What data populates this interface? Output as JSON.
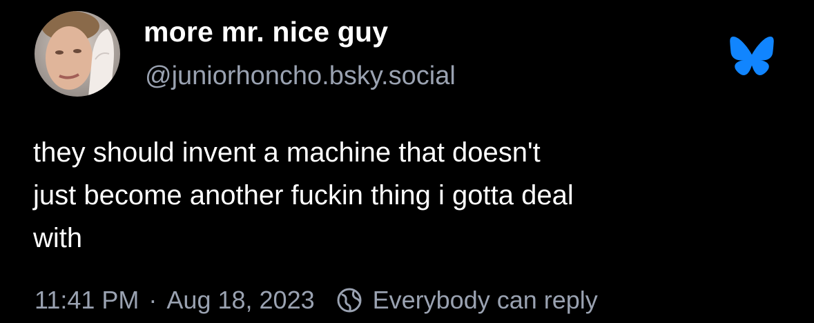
{
  "post": {
    "author": {
      "display_name": "more mr. nice guy",
      "handle": "@juniorhoncho.bsky.social"
    },
    "text_lines": [
      "they should invent a machine that doesn't",
      "just become another fuckin thing i gotta deal",
      "with"
    ],
    "meta": {
      "time": "11:41 PM",
      "separator": "·",
      "date": "Aug 18, 2023",
      "reply_setting": "Everybody can reply",
      "reply_icon": "globe-icon"
    }
  },
  "branding": {
    "logo_icon": "bluesky-butterfly-icon",
    "logo_color": "#1185fe"
  },
  "colors": {
    "background": "#000000",
    "text_primary": "#ffffff",
    "text_secondary": "#9aa2b1"
  }
}
